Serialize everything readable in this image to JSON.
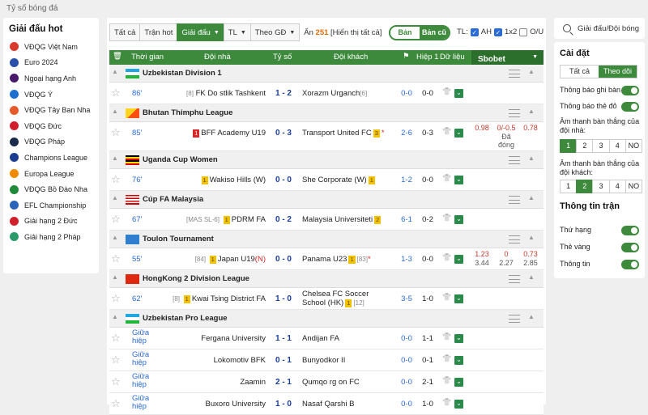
{
  "page_title": "Tỷ số bóng đá",
  "left": {
    "title": "Giải đấu hot",
    "items": [
      {
        "label": "VĐQG Việt Nam",
        "color": "#d93a2b"
      },
      {
        "label": "Euro 2024",
        "color": "#2a4fa8"
      },
      {
        "label": "Ngoại hạng Anh",
        "color": "#4a1a6a"
      },
      {
        "label": "VĐQG Ý",
        "color": "#1f6fd0"
      },
      {
        "label": "VĐQG Tây Ban Nha",
        "color": "#e6592a"
      },
      {
        "label": "VĐQG Đức",
        "color": "#d01f2a"
      },
      {
        "label": "VĐQG Pháp",
        "color": "#1b2a4a"
      },
      {
        "label": "Champions League",
        "color": "#1a3d8f"
      },
      {
        "label": "Europa League",
        "color": "#f08a00"
      },
      {
        "label": "VĐQG Bồ Đào Nha",
        "color": "#1f8a3a"
      },
      {
        "label": "EFL Championship",
        "color": "#2a63b8"
      },
      {
        "label": "Giải hạng 2 Đức",
        "color": "#d01f2a"
      },
      {
        "label": "Giải hạng 2 Pháp",
        "color": "#2a9a6a"
      }
    ]
  },
  "filters": {
    "all": "Tất cả",
    "hot": "Trận hot",
    "league": "Giải đấu",
    "tl": "TL",
    "sort": "Theo GĐ",
    "hidden_prefix": "Ẩn",
    "hidden_count": "251",
    "show_all": "[Hiển thị tất cả]",
    "new_version": "Bản mới",
    "old_version": "Bản cũ",
    "tl_label": "TL:",
    "ah": "AH",
    "x12": "1x2",
    "ou": "O/U"
  },
  "header": {
    "time": "Thời gian",
    "home": "Đội nhà",
    "score": "Tỷ số",
    "away": "Đội khách",
    "ht": "Hiệp 1",
    "data": "Dữ liệu",
    "sbobet": "Sbobet"
  },
  "leagues": [
    {
      "name": "Uzbekistan Division 1",
      "flag": "uz",
      "matches": [
        {
          "time": "86'",
          "home_rank": "[8]",
          "home": "FK Do stlik Tashkent",
          "score": "1 - 2",
          "away": "Xorazm Urganch",
          "away_rank": "[6]",
          "ht": "0-0",
          "h1": "0-0"
        }
      ]
    },
    {
      "name": "Bhutan Thimphu League",
      "flag": "bt",
      "matches": [
        {
          "time": "85'",
          "home_red": "1",
          "home": "BFF Academy U19",
          "score": "0 - 3",
          "away": "Transport United FC",
          "away_yellow": "3",
          "away_mark": "*",
          "ht": "2-6",
          "h1": "0-3",
          "odds": {
            "a": "0.98",
            "b": "0/-0.5",
            "c": "0.78",
            "note": "Đã đóng"
          }
        }
      ]
    },
    {
      "name": "Uganda Cup Women",
      "flag": "ug",
      "matches": [
        {
          "time": "76'",
          "home_yellow": "1",
          "home": "Wakiso Hills (W)",
          "score": "0 - 0",
          "away": "She Corporate (W)",
          "away_yellow": "1",
          "ht": "1-2",
          "h1": "0-0"
        }
      ]
    },
    {
      "name": "Cúp FA Malaysia",
      "flag": "my",
      "matches": [
        {
          "time": "67'",
          "home_rank": "[MAS SL-6]",
          "home_yellow": "1",
          "home": "PDRM FA",
          "score": "0 - 2",
          "away": "Malaysia Universiteti",
          "away_yellow": "2",
          "ht": "6-1",
          "h1": "0-2"
        }
      ]
    },
    {
      "name": "Toulon Tournament",
      "flag": "int",
      "matches": [
        {
          "time": "55'",
          "home_rank": "[84]",
          "home_yellow": "1",
          "home": "Japan U19",
          "home_suffix": "(N)",
          "score": "0 - 0",
          "away": "Panama U23",
          "away_yellow": "1",
          "away_rank": "[83]",
          "away_mark": "*",
          "ht": "1-3",
          "h1": "0-0",
          "odds": {
            "a": "1.23",
            "b": "0",
            "c": "0.73",
            "d": "3.44",
            "e": "2.27",
            "f": "2.85"
          }
        }
      ]
    },
    {
      "name": "HongKong 2 Division League",
      "flag": "cn",
      "matches": [
        {
          "time": "62'",
          "home_rank": "[8]",
          "home_yellow": "1",
          "home": "Kwai Tsing District FA",
          "score": "1 - 0",
          "away": "Chelsea FC Soccer School (HK)",
          "away_yellow": "1",
          "away_rank": "[12]",
          "ht": "3-5",
          "h1": "1-0"
        }
      ]
    },
    {
      "name": "Uzbekistan Pro League",
      "flag": "uz",
      "matches": [
        {
          "time": "Giữa hiệp",
          "home": "Fergana University",
          "score": "1 - 1",
          "away": "Andijan FA",
          "ht": "0-0",
          "h1": "1-1"
        },
        {
          "time": "Giữa hiệp",
          "home": "Lokomotiv BFK",
          "score": "0 - 1",
          "away": "Bunyodkor II",
          "ht": "0-0",
          "h1": "0-1"
        },
        {
          "time": "Giữa hiệp",
          "home": "Zaamin",
          "score": "2 - 1",
          "away": "Qumqo rg on FC",
          "ht": "0-0",
          "h1": "2-1"
        },
        {
          "time": "Giữa hiệp",
          "home": "Buxoro University",
          "score": "1 - 0",
          "away": "Nasaf Qarshi B",
          "ht": "0-0",
          "h1": "1-0"
        }
      ]
    }
  ],
  "right": {
    "search_label": "Giải đấu/Đội bóng",
    "settings_title": "Cài đặt",
    "seg_all": "Tất cả",
    "seg_follow": "Theo dõi",
    "notify_goal": "Thông báo ghi bàn",
    "notify_red": "Thông báo thẻ đỏ",
    "sound_home": "Âm thanh bàn thắng của đội nhà:",
    "sound_away": "Âm thanh bàn thắng của đội khách:",
    "sound_options": [
      "1",
      "2",
      "3",
      "4",
      "NO"
    ],
    "sound_home_selected": "1",
    "sound_away_selected": "2",
    "match_info_title": "Thông tin trận",
    "info_rank": "Thứ hạng",
    "info_yellow": "Thẻ vàng",
    "info_info": "Thông tin"
  },
  "colors": {
    "accent": "#3d8a3d",
    "link": "#2a6bd6",
    "score": "#1a3d99",
    "odds": "#c0392b"
  }
}
